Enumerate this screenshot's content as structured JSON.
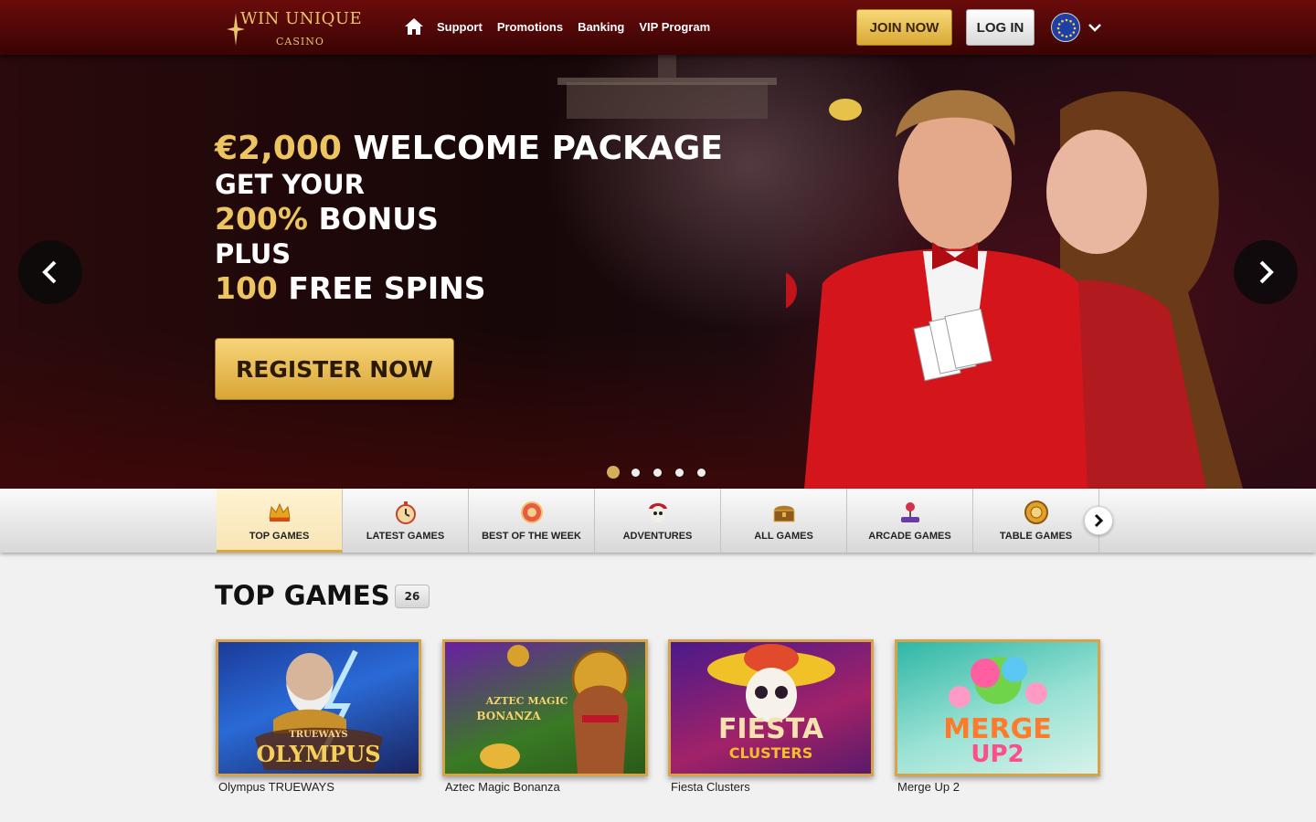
{
  "header": {
    "logo_main": "WIN UNIQUE",
    "logo_sub": "CASINO",
    "nav": [
      "Support",
      "Promotions",
      "Banking",
      "VIP Program"
    ],
    "join_label": "JOIN NOW",
    "login_label": "LOG IN"
  },
  "hero": {
    "amount": "€2,000",
    "line1_rest": " WELCOME PACKAGE",
    "line2": "GET YOUR",
    "bonus_pct": "200%",
    "bonus_rest": " BONUS",
    "line4": "PLUS",
    "spins_num": "100",
    "spins_rest": " FREE SPINS",
    "cta": "REGISTER NOW",
    "slides_total": 5,
    "slide_active": 1
  },
  "categories": [
    {
      "label": "TOP GAMES",
      "icon": "crown-icon",
      "active": true
    },
    {
      "label": "LATEST GAMES",
      "icon": "stopwatch-icon",
      "active": false
    },
    {
      "label": "BEST OF THE WEEK",
      "icon": "medal-icon",
      "active": false
    },
    {
      "label": "ADVENTURES",
      "icon": "pirate-skull-icon",
      "active": false
    },
    {
      "label": "ALL GAMES",
      "icon": "treasure-chest-icon",
      "active": false
    },
    {
      "label": "ARCADE GAMES",
      "icon": "joystick-icon",
      "active": false
    },
    {
      "label": "TABLE GAMES",
      "icon": "poker-chip-icon",
      "active": false
    }
  ],
  "games_section": {
    "title": "TOP GAMES",
    "count": "26",
    "games": [
      {
        "name": "Olympus TRUEWAYS",
        "thumb_line1": "TRUEWAYS",
        "thumb_line2": "OLYMPUS"
      },
      {
        "name": "Aztec Magic Bonanza",
        "thumb_line1": "AZTEC MAGIC",
        "thumb_line2": "BONANZA"
      },
      {
        "name": "Fiesta Clusters",
        "thumb_line1": "FIESTA",
        "thumb_line2": "CLUSTERS"
      },
      {
        "name": "Merge Up 2",
        "thumb_line1": "MERGE",
        "thumb_line2": "UP2"
      }
    ]
  },
  "colors": {
    "header_dark": "#3a0404",
    "gold": "#ecc460",
    "gold_button": "#d9a934"
  }
}
